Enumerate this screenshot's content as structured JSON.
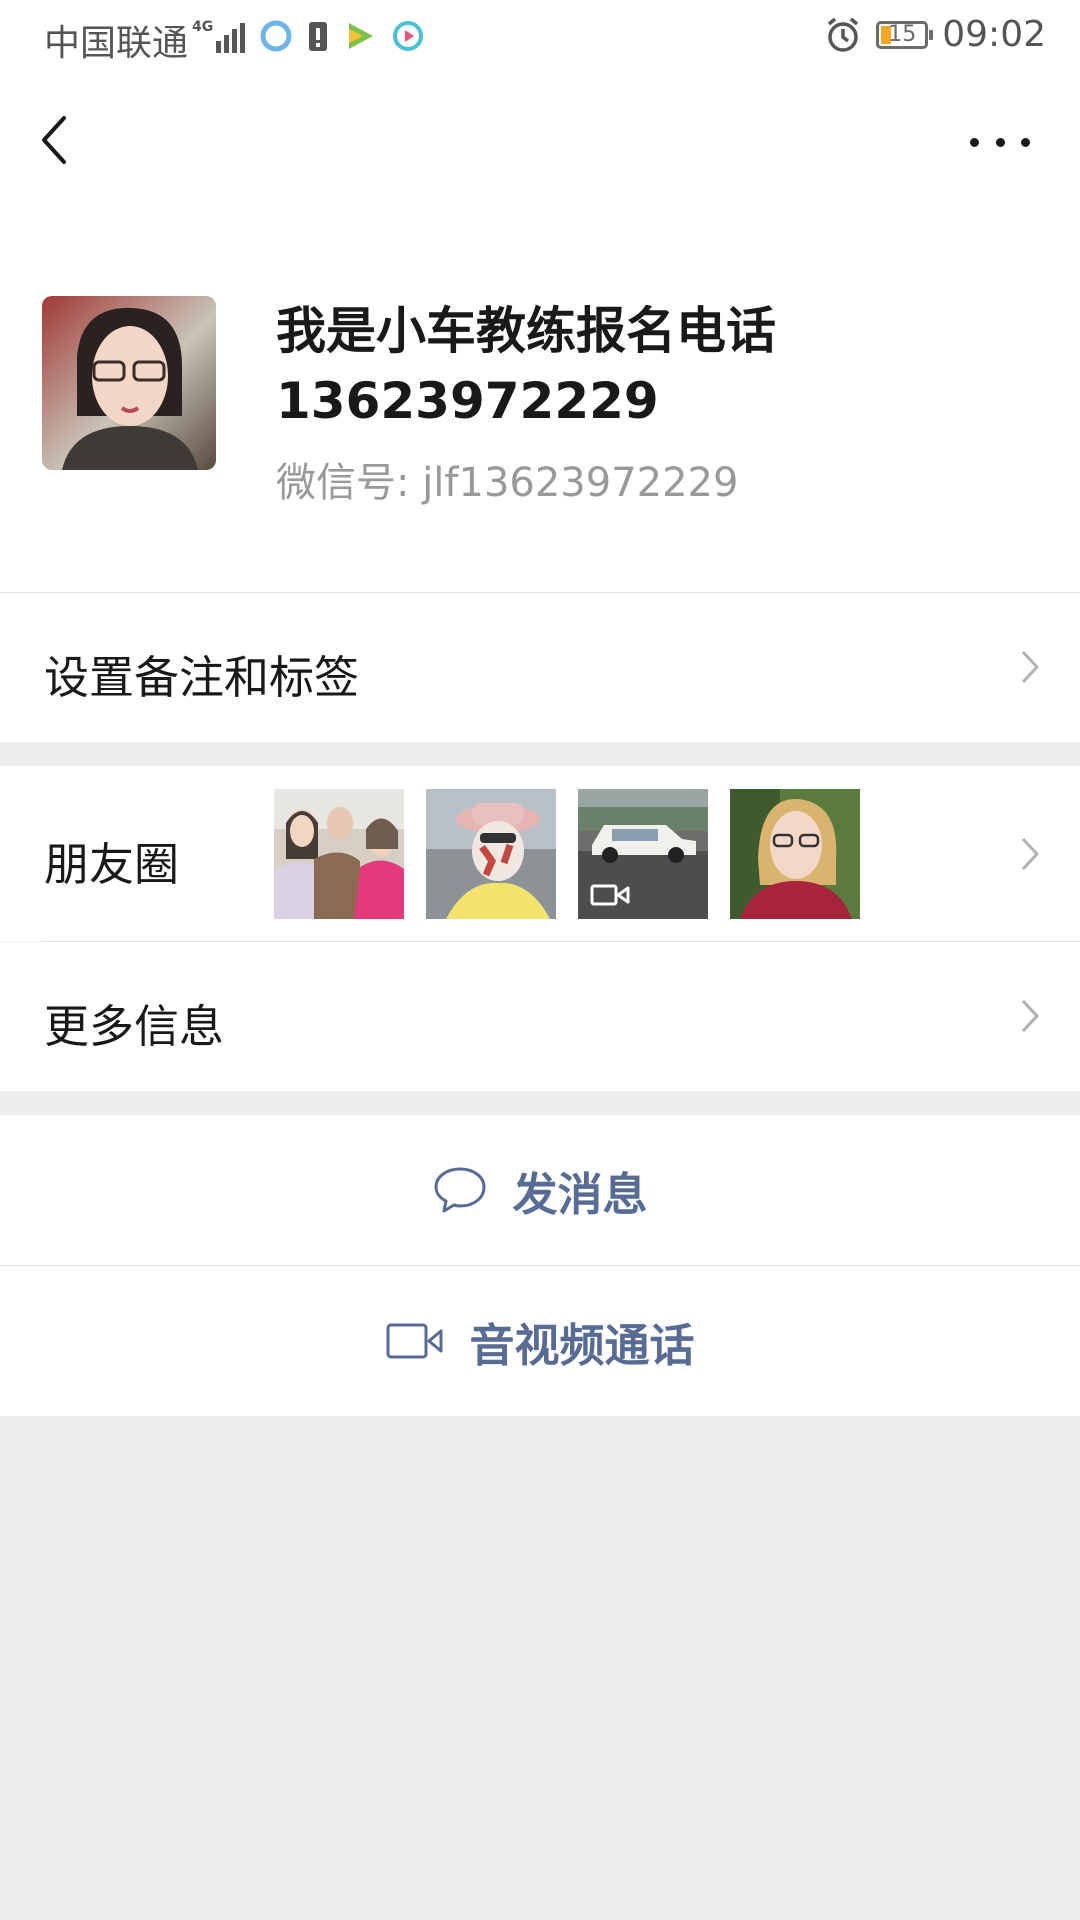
{
  "status_bar": {
    "carrier": "中国联通",
    "network": "4G",
    "battery": "15",
    "time": "09:02"
  },
  "nav": {
    "back_icon": "chevron-left-icon",
    "more_icon": "more-dots-icon"
  },
  "profile": {
    "display_name": "我是小车教练报名电话13623972229",
    "wechat_id": "微信号:  jlf13623972229"
  },
  "menu": {
    "remark_label": "设置备注和标签",
    "moments_label": "朋友圈",
    "more_info_label": "更多信息"
  },
  "actions": {
    "message_label": "发消息",
    "call_label": "音视频通话"
  },
  "colors": {
    "accent": "#576b95",
    "background": "#ededed",
    "surface": "#ffffff"
  }
}
